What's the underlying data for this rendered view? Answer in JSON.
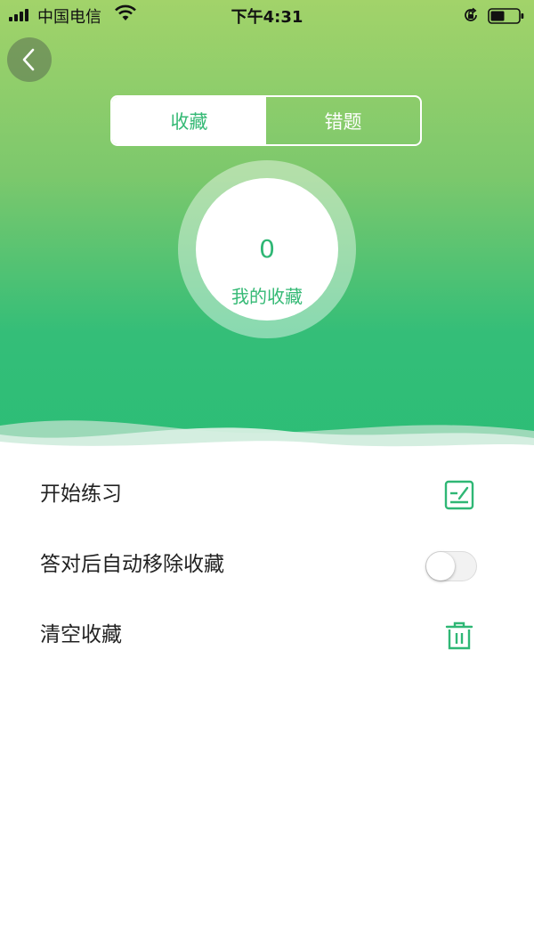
{
  "status_bar": {
    "carrier": "中国电信",
    "time": "下午4:31",
    "battery_level": 0.5,
    "icons": [
      "signal-icon",
      "wifi-icon",
      "rotation-lock-icon",
      "battery-icon"
    ]
  },
  "nav": {
    "back_icon": "chevron-left-icon"
  },
  "tabs": [
    {
      "label": "收藏",
      "active": true
    },
    {
      "label": "错题",
      "active": false
    }
  ],
  "summary": {
    "count": "0",
    "label": "我的收藏"
  },
  "list": {
    "start_practice": {
      "label": "开始练习",
      "icon": "edit-note-icon"
    },
    "auto_remove": {
      "label": "答对后自动移除收藏",
      "toggle_on": false
    },
    "clear": {
      "label": "清空收藏",
      "icon": "trash-icon"
    }
  },
  "colors": {
    "accent": "#2fb775",
    "gradient_top": "#a2d36a",
    "gradient_bottom": "#2bbd76",
    "text": "#222222"
  }
}
